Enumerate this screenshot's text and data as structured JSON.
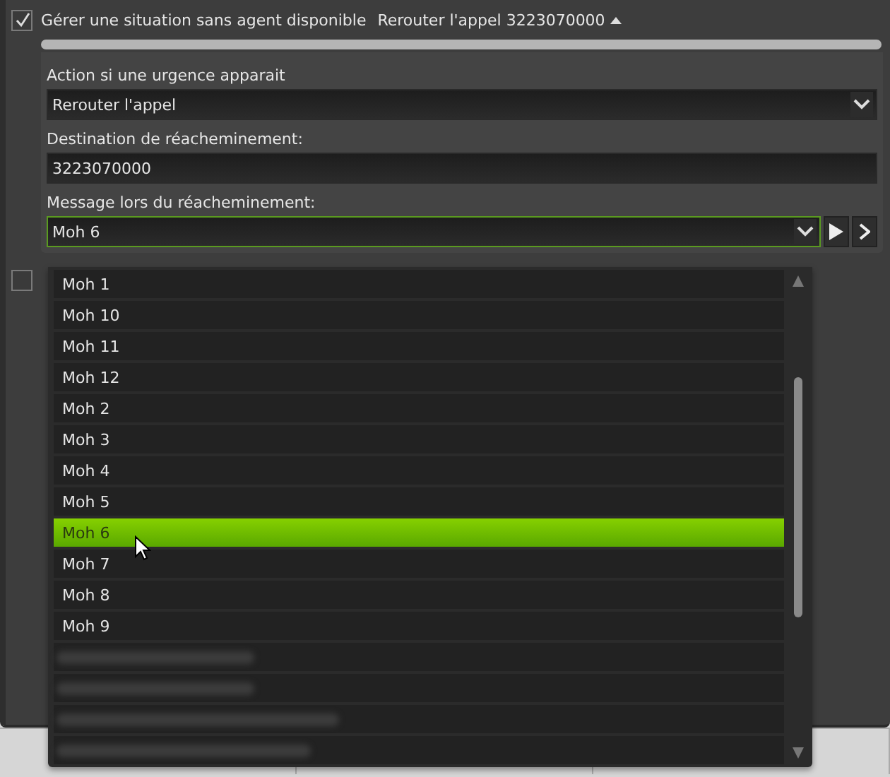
{
  "header": {
    "checked": true,
    "label": "Gérer une situation sans agent disponible",
    "summary": "Rerouter l'appel 3223070000",
    "expanded": true
  },
  "emergency_action": {
    "label": "Action si une urgence apparait",
    "value": "Rerouter l'appel"
  },
  "destination": {
    "label": "Destination de réacheminement:",
    "value": "3223070000"
  },
  "message": {
    "label": "Message lors du réacheminement:",
    "value": "Moh 6"
  },
  "second_option": {
    "checked": false
  },
  "dropdown": {
    "items": [
      {
        "kind": "option",
        "label": "Moh 1",
        "selected": false
      },
      {
        "kind": "option",
        "label": "Moh 10",
        "selected": false
      },
      {
        "kind": "option",
        "label": "Moh 11",
        "selected": false
      },
      {
        "kind": "option",
        "label": "Moh 12",
        "selected": false
      },
      {
        "kind": "option",
        "label": "Moh 2",
        "selected": false
      },
      {
        "kind": "option",
        "label": "Moh 3",
        "selected": false
      },
      {
        "kind": "option",
        "label": "Moh 4",
        "selected": false
      },
      {
        "kind": "option",
        "label": "Moh 5",
        "selected": false
      },
      {
        "kind": "option",
        "label": "Moh 6",
        "selected": true
      },
      {
        "kind": "option",
        "label": "Moh 7",
        "selected": false
      },
      {
        "kind": "option",
        "label": "Moh 8",
        "selected": false
      },
      {
        "kind": "option",
        "label": "Moh 9",
        "selected": false
      },
      {
        "kind": "blurred"
      },
      {
        "kind": "blurred"
      },
      {
        "kind": "blurred"
      },
      {
        "kind": "blurred"
      }
    ]
  }
}
